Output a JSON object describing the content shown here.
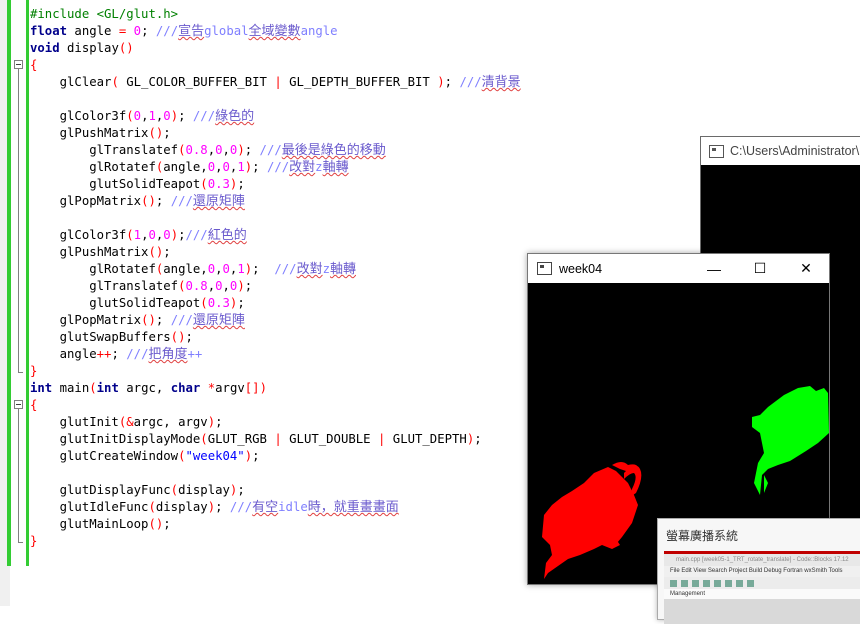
{
  "editor": {
    "lines": [
      [
        {
          "c": "pp",
          "t": "#include <GL/glut.h>"
        }
      ],
      [
        {
          "c": "kw",
          "t": "float"
        },
        {
          "t": " angle "
        },
        {
          "c": "op",
          "t": "="
        },
        {
          "t": " "
        },
        {
          "c": "num",
          "t": "0"
        },
        {
          "t": "; "
        },
        {
          "c": "cm",
          "t": "///宣告global全域變數angle"
        }
      ],
      [
        {
          "c": "kw",
          "t": "void"
        },
        {
          "t": " display"
        },
        {
          "c": "op",
          "t": "()"
        }
      ],
      [
        {
          "c": "op",
          "t": "{"
        }
      ],
      [
        {
          "t": "    glClear"
        },
        {
          "c": "op",
          "t": "("
        },
        {
          "t": " GL_COLOR_BUFFER_BIT "
        },
        {
          "c": "op",
          "t": "|"
        },
        {
          "t": " GL_DEPTH_BUFFER_BIT "
        },
        {
          "c": "op",
          "t": ")"
        },
        {
          "t": "; "
        },
        {
          "c": "cm",
          "t": "///清背景"
        }
      ],
      [
        {
          "t": ""
        }
      ],
      [
        {
          "t": "    glColor3f"
        },
        {
          "c": "op",
          "t": "("
        },
        {
          "c": "num",
          "t": "0"
        },
        {
          "t": ","
        },
        {
          "c": "num",
          "t": "1"
        },
        {
          "t": ","
        },
        {
          "c": "num",
          "t": "0"
        },
        {
          "c": "op",
          "t": ")"
        },
        {
          "t": "; "
        },
        {
          "c": "cm",
          "t": "///綠色的"
        }
      ],
      [
        {
          "t": "    glPushMatrix"
        },
        {
          "c": "op",
          "t": "()"
        },
        {
          "t": ";"
        }
      ],
      [
        {
          "t": "        glTranslatef"
        },
        {
          "c": "op",
          "t": "("
        },
        {
          "c": "num",
          "t": "0.8"
        },
        {
          "t": ","
        },
        {
          "c": "num",
          "t": "0"
        },
        {
          "t": ","
        },
        {
          "c": "num",
          "t": "0"
        },
        {
          "c": "op",
          "t": ")"
        },
        {
          "t": "; "
        },
        {
          "c": "cm",
          "t": "///最後是綠色的移動"
        }
      ],
      [
        {
          "t": "        glRotatef"
        },
        {
          "c": "op",
          "t": "("
        },
        {
          "t": "angle,"
        },
        {
          "c": "num",
          "t": "0"
        },
        {
          "t": ","
        },
        {
          "c": "num",
          "t": "0"
        },
        {
          "t": ","
        },
        {
          "c": "num",
          "t": "1"
        },
        {
          "c": "op",
          "t": ")"
        },
        {
          "t": "; "
        },
        {
          "c": "cm",
          "t": "///改對z軸轉"
        }
      ],
      [
        {
          "t": "        glutSolidTeapot"
        },
        {
          "c": "op",
          "t": "("
        },
        {
          "c": "num",
          "t": "0.3"
        },
        {
          "c": "op",
          "t": ")"
        },
        {
          "t": ";"
        }
      ],
      [
        {
          "t": "    glPopMatrix"
        },
        {
          "c": "op",
          "t": "()"
        },
        {
          "t": "; "
        },
        {
          "c": "cm",
          "t": "///還原矩陣"
        }
      ],
      [
        {
          "t": ""
        }
      ],
      [
        {
          "t": "    glColor3f"
        },
        {
          "c": "op",
          "t": "("
        },
        {
          "c": "num",
          "t": "1"
        },
        {
          "t": ","
        },
        {
          "c": "num",
          "t": "0"
        },
        {
          "t": ","
        },
        {
          "c": "num",
          "t": "0"
        },
        {
          "c": "op",
          "t": ")"
        },
        {
          "t": ";"
        },
        {
          "c": "cm",
          "t": "///紅色的"
        }
      ],
      [
        {
          "t": "    glPushMatrix"
        },
        {
          "c": "op",
          "t": "()"
        },
        {
          "t": ";"
        }
      ],
      [
        {
          "t": "        glRotatef"
        },
        {
          "c": "op",
          "t": "("
        },
        {
          "t": "angle,"
        },
        {
          "c": "num",
          "t": "0"
        },
        {
          "t": ","
        },
        {
          "c": "num",
          "t": "0"
        },
        {
          "t": ","
        },
        {
          "c": "num",
          "t": "1"
        },
        {
          "c": "op",
          "t": ")"
        },
        {
          "t": ";  "
        },
        {
          "c": "cm",
          "t": "///改對z軸轉"
        }
      ],
      [
        {
          "t": "        glTranslatef"
        },
        {
          "c": "op",
          "t": "("
        },
        {
          "c": "num",
          "t": "0.8"
        },
        {
          "t": ","
        },
        {
          "c": "num",
          "t": "0"
        },
        {
          "t": ","
        },
        {
          "c": "num",
          "t": "0"
        },
        {
          "c": "op",
          "t": ")"
        },
        {
          "t": ";"
        }
      ],
      [
        {
          "t": "        glutSolidTeapot"
        },
        {
          "c": "op",
          "t": "("
        },
        {
          "c": "num",
          "t": "0.3"
        },
        {
          "c": "op",
          "t": ")"
        },
        {
          "t": ";"
        }
      ],
      [
        {
          "t": "    glPopMatrix"
        },
        {
          "c": "op",
          "t": "()"
        },
        {
          "t": "; "
        },
        {
          "c": "cm",
          "t": "///還原矩陣"
        }
      ],
      [
        {
          "t": "    glutSwapBuffers"
        },
        {
          "c": "op",
          "t": "()"
        },
        {
          "t": ";"
        }
      ],
      [
        {
          "t": "    angle"
        },
        {
          "c": "op",
          "t": "++"
        },
        {
          "t": "; "
        },
        {
          "c": "cm",
          "t": "///把角度++"
        }
      ],
      [
        {
          "c": "op",
          "t": "}"
        }
      ],
      [
        {
          "c": "kw",
          "t": "int"
        },
        {
          "t": " main"
        },
        {
          "c": "op",
          "t": "("
        },
        {
          "c": "kw",
          "t": "int"
        },
        {
          "t": " argc, "
        },
        {
          "c": "kw",
          "t": "char"
        },
        {
          "t": " "
        },
        {
          "c": "op",
          "t": "*"
        },
        {
          "t": "argv"
        },
        {
          "c": "op",
          "t": "[])"
        }
      ],
      [
        {
          "c": "op",
          "t": "{"
        }
      ],
      [
        {
          "t": "    glutInit"
        },
        {
          "c": "op",
          "t": "(&"
        },
        {
          "t": "argc, argv"
        },
        {
          "c": "op",
          "t": ")"
        },
        {
          "t": ";"
        }
      ],
      [
        {
          "t": "    glutInitDisplayMode"
        },
        {
          "c": "op",
          "t": "("
        },
        {
          "t": "GLUT_RGB "
        },
        {
          "c": "op",
          "t": "|"
        },
        {
          "t": " GLUT_DOUBLE "
        },
        {
          "c": "op",
          "t": "|"
        },
        {
          "t": " GLUT_DEPTH"
        },
        {
          "c": "op",
          "t": ")"
        },
        {
          "t": ";"
        }
      ],
      [
        {
          "t": "    glutCreateWindow"
        },
        {
          "c": "op",
          "t": "("
        },
        {
          "c": "str",
          "t": "\"week04\""
        },
        {
          "c": "op",
          "t": ")"
        },
        {
          "t": ";"
        }
      ],
      [
        {
          "t": ""
        }
      ],
      [
        {
          "t": "    glutDisplayFunc"
        },
        {
          "c": "op",
          "t": "("
        },
        {
          "t": "display"
        },
        {
          "c": "op",
          "t": ")"
        },
        {
          "t": ";"
        }
      ],
      [
        {
          "t": "    glutIdleFunc"
        },
        {
          "c": "op",
          "t": "("
        },
        {
          "t": "display"
        },
        {
          "c": "op",
          "t": ")"
        },
        {
          "t": "; "
        },
        {
          "c": "cm",
          "t": "///有空idle時，就重畫畫面"
        }
      ],
      [
        {
          "t": "    glutMainLoop"
        },
        {
          "c": "op",
          "t": "()"
        },
        {
          "t": ";"
        }
      ],
      [
        {
          "c": "op",
          "t": "}"
        }
      ]
    ]
  },
  "console_window": {
    "title": "C:\\Users\\Administrator\\"
  },
  "gl_window": {
    "title": "week04",
    "minimize": "—",
    "maximize": "☐",
    "close": "✕",
    "colors": {
      "red_teapot": "#ff0000",
      "green_teapot": "#00ff00",
      "background": "#000000"
    }
  },
  "broadcast_window": {
    "title": "螢幕廣播系統",
    "mini_title": "main.cpp [week05-1_TRT_rotate_translate] - Code::Blocks 17.12",
    "mini_menu": "File  Edit  View  Search  Project  Build  Debug  Fortran  wxSmith  Tools",
    "mini_management": "Management"
  }
}
